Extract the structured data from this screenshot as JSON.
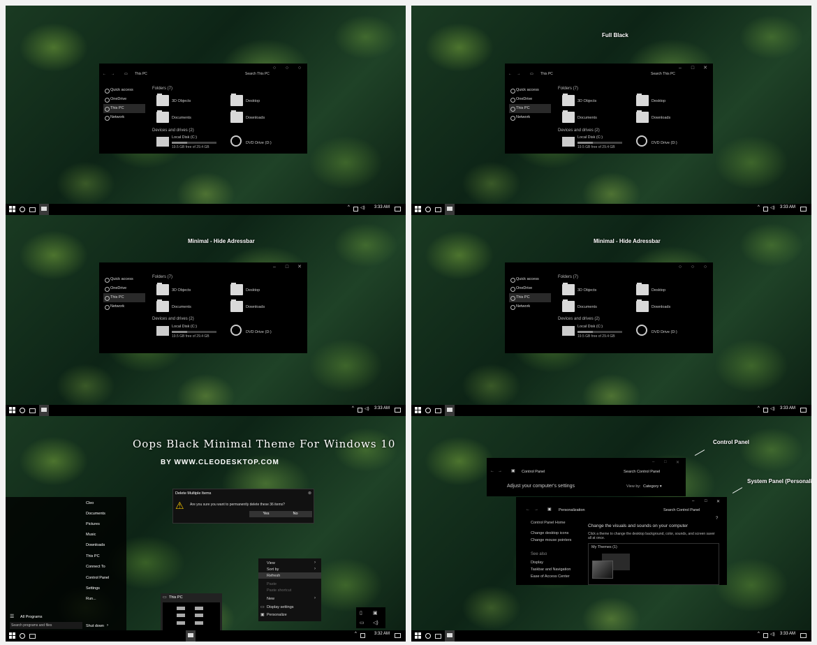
{
  "explorer": {
    "location": "This PC",
    "search_placeholder": "Search This PC",
    "nav": [
      "Quick access",
      "OneDrive",
      "This PC",
      "Network"
    ],
    "folders_header": "Folders (7)",
    "folders": [
      "3D Objects",
      "Desktop",
      "Documents",
      "Downloads"
    ],
    "devices_header": "Devices and drives (2)",
    "local_disk": {
      "name": "Local Disk (C:)",
      "free_text": "19.5 GB free of 29.4 GB",
      "used_fraction": 0.34
    },
    "dvd": {
      "name": "DVD Drive (D:)",
      "badge": "DVD"
    }
  },
  "captions": {
    "full_black": "Full Black",
    "minimal_hide": "Minimal - Hide Adressbar",
    "title": "Oops Black Minimal Theme For Windows 10",
    "by": "BY WWW.CLEODESKTOP.COM",
    "control_panel": "Control Panel",
    "system_panel": "System Panel (Personalization)"
  },
  "taskbar": {
    "time": "3:33 AM",
    "time_alt": "3:32 AM"
  },
  "startmenu": {
    "items": [
      "Cleo",
      "Documents",
      "Pictures",
      "Music",
      "Downloads",
      "This PC",
      "Connect To",
      "Control Panel",
      "Settings",
      "Run..."
    ],
    "all_programs": "All Programs",
    "search_placeholder": "Search programs and files",
    "shutdown": "Shut down"
  },
  "dialog": {
    "title": "Delete Multiple Items",
    "message": "Are you sure you want to permanently delete these 36 items?",
    "yes": "Yes",
    "no": "No"
  },
  "context_menu": {
    "items": [
      {
        "label": "View",
        "arrow": true,
        "disabled": false
      },
      {
        "label": "Sort by",
        "arrow": true,
        "disabled": false
      },
      {
        "label": "Refresh",
        "arrow": false,
        "disabled": false
      },
      {
        "label": "Paste",
        "arrow": false,
        "disabled": true
      },
      {
        "label": "Paste shortcut",
        "arrow": false,
        "disabled": true
      },
      {
        "label": "New",
        "arrow": true,
        "disabled": false
      },
      {
        "label": "Display settings",
        "arrow": false,
        "disabled": false
      },
      {
        "label": "Personalize",
        "arrow": false,
        "disabled": false
      }
    ]
  },
  "thumbnail": {
    "title": "This PC"
  },
  "control_panel": {
    "title": "Control Panel",
    "search": "Search Control Panel",
    "heading": "Adjust your computer's settings",
    "view_by": "View by:",
    "category": "Category ▾"
  },
  "personalization": {
    "title": "Personalization",
    "search": "Search Control Panel",
    "home": "Control Panel Home",
    "links": [
      "Change desktop icons",
      "Change mouse pointers"
    ],
    "heading": "Change the visuals and sounds on your computer",
    "desc": "Click a theme to change the desktop background, color, sounds, and screen saver all at once.",
    "my_themes": "My Themes (1)",
    "see_also": "See also",
    "see_also_links": [
      "Display",
      "Taskbar and Navigation",
      "Ease of Access Center"
    ]
  }
}
